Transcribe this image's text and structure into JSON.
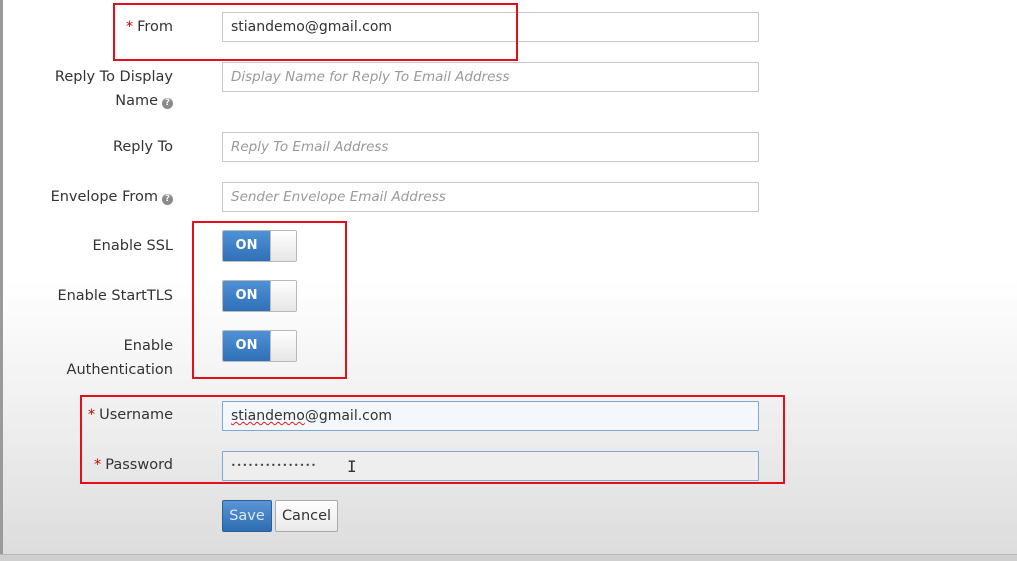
{
  "form": {
    "from": {
      "label": "From",
      "required_mark": "*",
      "value": "stiandemo@gmail.com"
    },
    "reply_to_display_name": {
      "label_line1": "Reply To Display",
      "label_line2": "Name",
      "help_icon": "?",
      "placeholder": "Display Name for Reply To Email Address"
    },
    "reply_to": {
      "label": "Reply To",
      "placeholder": "Reply To Email Address"
    },
    "envelope_from": {
      "label": "Envelope From",
      "help_icon": "?",
      "placeholder": "Sender Envelope Email Address"
    },
    "enable_ssl": {
      "label": "Enable SSL",
      "state": "ON"
    },
    "enable_starttls": {
      "label": "Enable StartTLS",
      "state": "ON"
    },
    "enable_authentication": {
      "label_line1": "Enable",
      "label_line2": "Authentication",
      "state": "ON"
    },
    "username": {
      "label": "Username",
      "required_mark": "*",
      "value_underlined": "stiandemo",
      "value_rest": "@gmail.com"
    },
    "password": {
      "label": "Password",
      "required_mark": "*",
      "masked_value": "•••••••••••••••"
    },
    "text_cursor": "I"
  },
  "buttons": {
    "save": "Save",
    "cancel": "Cancel"
  },
  "colors": {
    "highlight": "#e3101a",
    "toggle_on": "#3a7fc9",
    "required": "#cc0000"
  }
}
